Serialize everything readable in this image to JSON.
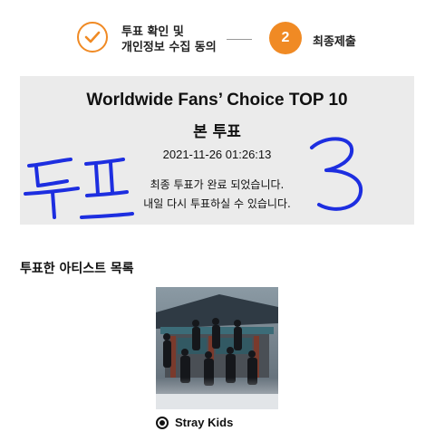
{
  "steps": {
    "step1": {
      "label_line1": "투표 확인 및",
      "label_line2": "개인정보 수집 동의",
      "status": "done"
    },
    "step2": {
      "number": "2",
      "label": "최종제출",
      "status": "active"
    },
    "accent_color": "#f08a24"
  },
  "result": {
    "title": "Worldwide Fans’ Choice TOP 10",
    "subtitle": "본 투표",
    "timestamp": "2021-11-26 01:26:13",
    "message_line1": "최종 투표가 완료 되었습니다.",
    "message_line2": "내일 다시 투표하실 수 있습니다."
  },
  "handwriting": {
    "text": "투표 3",
    "color": "#1d2ee0"
  },
  "voted_list": {
    "heading": "투표한 아티스트 목록",
    "artists": [
      {
        "name": "Stray Kids",
        "selected": true,
        "photo": "group-photo"
      }
    ]
  }
}
